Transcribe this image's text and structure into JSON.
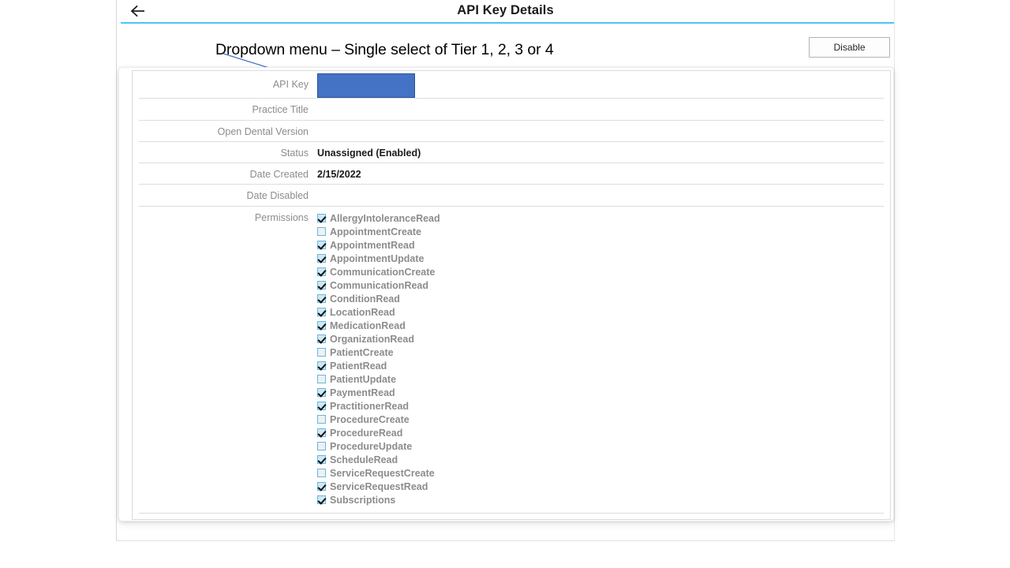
{
  "header": {
    "back_icon": "arrow-left-icon",
    "title": "API Key Details",
    "accent_color": "#4fc3f7"
  },
  "annotation": {
    "text": "Dropdown menu – Single select of Tier 1, 2, 3 or 4",
    "arrow_color": "#4472c4",
    "points_to": "Open Dental Version"
  },
  "toolbar": {
    "disable_label": "Disable"
  },
  "details": {
    "fields": [
      {
        "label": "API Key",
        "value": "",
        "redacted": true,
        "redaction_color": "#4472c4"
      },
      {
        "label": "Practice Title",
        "value": ""
      },
      {
        "label": "Open Dental Version",
        "value": ""
      },
      {
        "label": "Status",
        "value": "Unassigned (Enabled)"
      },
      {
        "label": "Date Created",
        "value": "2/15/2022"
      },
      {
        "label": "Date Disabled",
        "value": ""
      }
    ],
    "permissions_label": "Permissions",
    "permissions": [
      {
        "label": "AllergyIntoleranceRead",
        "checked": true
      },
      {
        "label": "AppointmentCreate",
        "checked": false
      },
      {
        "label": "AppointmentRead",
        "checked": true
      },
      {
        "label": "AppointmentUpdate",
        "checked": true
      },
      {
        "label": "CommunicationCreate",
        "checked": true
      },
      {
        "label": "CommunicationRead",
        "checked": true
      },
      {
        "label": "ConditionRead",
        "checked": true
      },
      {
        "label": "LocationRead",
        "checked": true
      },
      {
        "label": "MedicationRead",
        "checked": true
      },
      {
        "label": "OrganizationRead",
        "checked": true
      },
      {
        "label": "PatientCreate",
        "checked": false
      },
      {
        "label": "PatientRead",
        "checked": true
      },
      {
        "label": "PatientUpdate",
        "checked": false
      },
      {
        "label": "PaymentRead",
        "checked": true
      },
      {
        "label": "PractitionerRead",
        "checked": true
      },
      {
        "label": "ProcedureCreate",
        "checked": false
      },
      {
        "label": "ProcedureRead",
        "checked": true
      },
      {
        "label": "ProcedureUpdate",
        "checked": false
      },
      {
        "label": "ScheduleRead",
        "checked": true
      },
      {
        "label": "ServiceRequestCreate",
        "checked": false
      },
      {
        "label": "ServiceRequestRead",
        "checked": true
      },
      {
        "label": "Subscriptions",
        "checked": true
      }
    ]
  }
}
